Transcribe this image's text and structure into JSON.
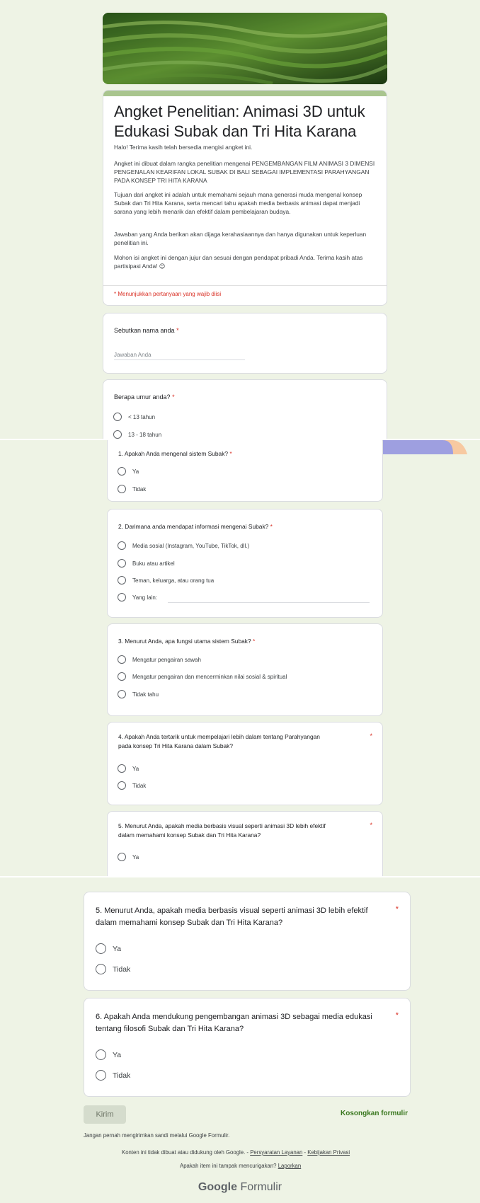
{
  "form": {
    "title": "Angket Penelitian: Animasi 3D untuk Edukasi Subak dan Tri Hita Karana",
    "description": [
      "Halo! Terima kasih telah bersedia mengisi angket ini.",
      "Angket ini dibuat dalam rangka penelitian mengenai PENGEMBANGAN FILM ANIMASI 3 DIMENSI PENGENALAN KEARIFAN LOKAL SUBAK DI BALI SEBAGAI IMPLEMENTASI PARAHYANGAN PADA KONSEP TRI HITA KARANA",
      "Tujuan dari angket ini adalah untuk memahami sejauh mana generasi muda mengenal konsep Subak dan Tri Hita Karana, serta mencari tahu apakah media berbasis animasi dapat menjadi sarana yang lebih menarik dan efektif dalam pembelajaran budaya.",
      "Jawaban yang Anda berikan akan dijaga kerahasiaannya dan hanya digunakan untuk keperluan penelitian ini.",
      "Mohon isi angket ini dengan jujur dan sesuai dengan pendapat pribadi Anda. Terima kasih atas partisipasi Anda! 😊"
    ],
    "required_note": "* Menunjukkan pertanyaan yang wajib diisi",
    "accent_color": "#a9c58e",
    "required_color": "#d93025"
  },
  "q_name": {
    "label": "Sebutkan nama anda",
    "placeholder": "Jawaban Anda"
  },
  "q_age": {
    "label": "Berapa umur anda?",
    "options": [
      "< 13 tahun",
      "13 - 18 tahun"
    ]
  },
  "q1": {
    "label": "1. Apakah Anda mengenal sistem Subak?",
    "options": [
      "Ya",
      "Tidak"
    ]
  },
  "q2": {
    "label": "2. Darimana anda mendapat informasi mengenai Subak?",
    "options": [
      "Media sosial (Instagram, YouTube, TikTok, dll.)",
      "Buku atau artikel",
      "Teman, keluarga, atau orang tua",
      "Yang lain:"
    ]
  },
  "q3": {
    "label": "3. Menurut Anda, apa fungsi utama sistem Subak?",
    "options": [
      "Mengatur pengairan sawah",
      "Mengatur pengairan dan mencerminkan nilai sosial & spiritual",
      "Tidak tahu"
    ]
  },
  "q4": {
    "label_line1": "4. Apakah Anda tertarik untuk mempelajari lebih dalam tentang Parahyangan",
    "label_line2": "pada konsep Tri Hita Karana dalam Subak?",
    "options": [
      "Ya",
      "Tidak"
    ]
  },
  "q5": {
    "label_line1": "5. Menurut Anda, apakah media berbasis visual seperti animasi 3D lebih efektif",
    "label_line2": "dalam memahami konsep Subak dan Tri Hita Karana?",
    "options": [
      "Ya",
      "Tidak"
    ],
    "partial_option": "Ya"
  },
  "q6": {
    "label_line1": "6. Apakah Anda mendukung pengembangan animasi 3D sebagai media edukasi",
    "label_line2": "tentang filosofi Subak dan Tri Hita Karana?",
    "options": [
      "Ya",
      "Tidak"
    ]
  },
  "actions": {
    "submit": "Kirim",
    "clear": "Kosongkan formulir"
  },
  "footer": {
    "password_warning": "Jangan pernah mengirimkan sandi melalui Google Formulir.",
    "disclaimer": "Konten ini tidak dibuat atau didukung oleh Google.",
    "dash": " - ",
    "terms": "Persyaratan Layanan",
    "privacy": "Kebijakan Privasi",
    "suspicious": "Apakah item ini tampak mencurigakan?",
    "report": "Laporkan",
    "logo_google": "Google",
    "logo_forms": "Formulir"
  }
}
